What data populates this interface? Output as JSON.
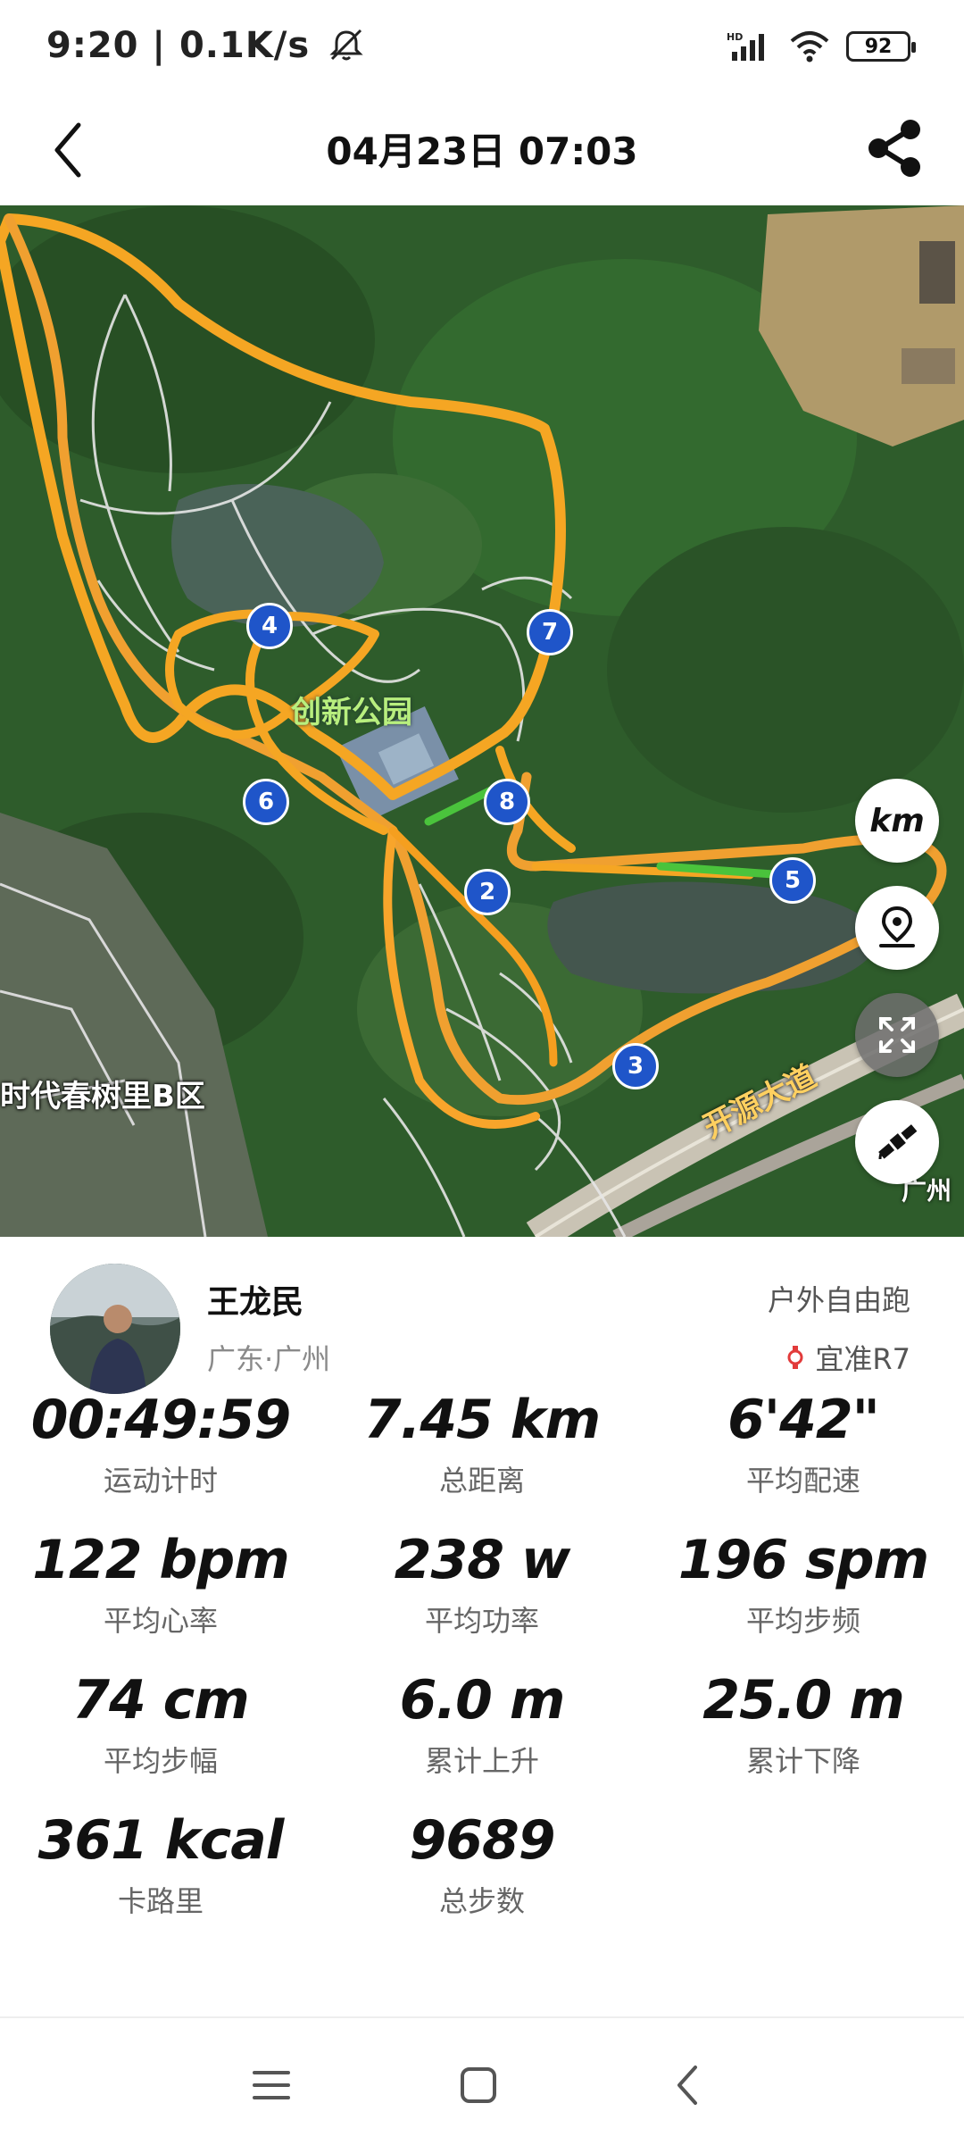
{
  "status_bar": {
    "time": "9:20 | 0.1K/s",
    "battery": "92",
    "network": "HD"
  },
  "header": {
    "title": "04月23日 07:03"
  },
  "map": {
    "labels": {
      "park": "创新公园",
      "district": "时代春树里B区",
      "road": "开源大道",
      "city": "广州"
    },
    "markers": [
      "2",
      "3",
      "4",
      "5",
      "6",
      "7",
      "8"
    ],
    "controls": {
      "unit": "km"
    },
    "route_color": "#f5a623",
    "fast_color": "#4ac33c"
  },
  "profile": {
    "name": "王龙民",
    "location": "广东·广州",
    "activity_type": "户外自由跑",
    "device": "宜准R7"
  },
  "stats": [
    {
      "value": "00:49:59",
      "label": "运动计时"
    },
    {
      "value": "7.45 km",
      "label": "总距离"
    },
    {
      "value": "6'42\"",
      "label": "平均配速"
    },
    {
      "value": "122 bpm",
      "label": "平均心率"
    },
    {
      "value": "238 w",
      "label": "平均功率"
    },
    {
      "value": "196 spm",
      "label": "平均步频"
    },
    {
      "value": "74 cm",
      "label": "平均步幅"
    },
    {
      "value": "6.0 m",
      "label": "累计上升"
    },
    {
      "value": "25.0 m",
      "label": "累计下降"
    },
    {
      "value": "361 kcal",
      "label": "卡路里"
    },
    {
      "value": "9689",
      "label": "总步数"
    }
  ]
}
